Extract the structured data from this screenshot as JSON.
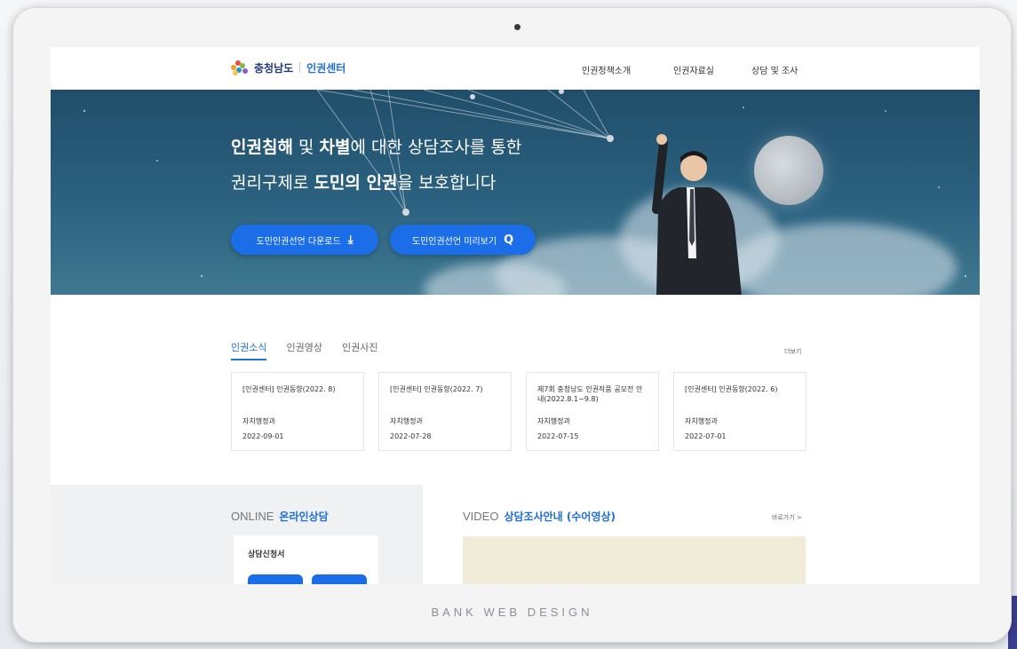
{
  "header": {
    "logo_name": "충청남도",
    "logo_sub": "인권센터",
    "nav": [
      "인권정책소개",
      "인권자료실",
      "상담 및 조사"
    ]
  },
  "hero": {
    "line1": {
      "b1": "인권침해",
      "t1": " 및 ",
      "b2": "차별",
      "t2": "에 대한 상담조사를 통한"
    },
    "line2": {
      "t1": "권리구제로 ",
      "b1": "도민의 인권",
      "t2": "을 보호합니다"
    },
    "buttons": [
      {
        "label": "도민인권선언 다운로드",
        "icon": "download-icon",
        "glyph": "⤓"
      },
      {
        "label": "도민인권선언 미리보기",
        "icon": "search-icon",
        "glyph": "Q"
      }
    ]
  },
  "news": {
    "tabs": [
      "인권소식",
      "인권영상",
      "인권사진"
    ],
    "active_tab": 0,
    "more_label": "더보기",
    "cards": [
      {
        "title": "[인권센터] 인권동향(2022. 8)",
        "dept": "자치행정과",
        "date": "2022-09-01"
      },
      {
        "title": "[인권센터] 인권동향(2022. 7)",
        "dept": "자치행정과",
        "date": "2022-07-28"
      },
      {
        "title": "제7회 충청남도 인권작품 공모전 안내(2022.8.1~9.8)",
        "dept": "자치행정과",
        "date": "2022-07-15"
      },
      {
        "title": "[인권센터] 인권동향(2022. 6)",
        "dept": "자치행정과",
        "date": "2022-07-01"
      }
    ]
  },
  "online": {
    "eng": "ONLINE",
    "kor": "온라인상담",
    "card_title": "상담신청서"
  },
  "video": {
    "eng": "VIDEO",
    "kor": "상담조사안내 (수어영상)",
    "link": "바로가기 >"
  },
  "footer_brand": "BANK WEB DESIGN",
  "colors": {
    "primary_blue": "#1b6ee8",
    "hero_bg": "#204e6a",
    "logo_navy": "#233a7a",
    "video_placeholder": "#f1ecd9"
  }
}
